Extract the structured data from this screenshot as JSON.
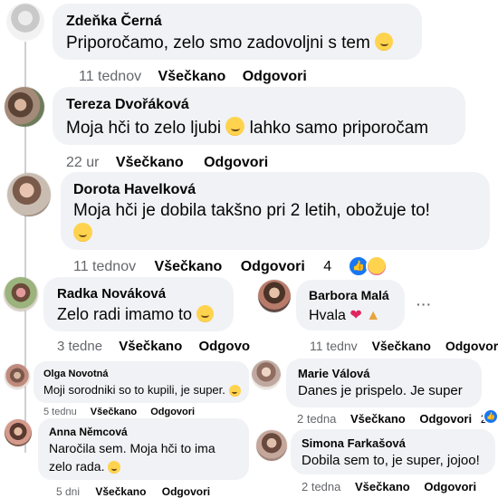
{
  "comments": [
    {
      "name": "Zdeňka Černá",
      "text": "Priporočamo, zelo smo zadovoljni s tem",
      "time": "11 tednov",
      "like": "Všečkano",
      "reply": "Odgovori",
      "emoji": "smiling-face"
    },
    {
      "name": "Tereza Dvořáková",
      "text_before": "Moja hči to zelo ljubi",
      "text_after": "lahko samo priporočam",
      "time": "22 ur",
      "like": "Všečkano",
      "reply": "Odgovori",
      "emoji": "blushing-face"
    },
    {
      "name": "Dorota Havelková",
      "text": "Moja hči je dobila takšno pri 2 letih, obožuje to!",
      "time": "11 tednov",
      "like": "Všečkano",
      "reply": "Odgovori",
      "reaction_count": "4",
      "emoji": "heart-eyes-face"
    },
    {
      "name": "Radka Nováková",
      "text": "Zelo radi imamo to",
      "time": "3 tedne",
      "like": "Všečkano",
      "reply": "Odgovo",
      "emoji": "smiling-face"
    },
    {
      "name": "Barbora Malá",
      "text": "Hvala",
      "time": "11 tednv",
      "like": "Všečkano",
      "reply": "Odgovor",
      "emoji": "heart-and-party-popper"
    },
    {
      "name": "Olga Novotná",
      "text": "Moji sorodniki so to kupili, je super.",
      "time": "5 tednu",
      "like": "Všečkano",
      "reply": "Odgovori",
      "emoji": "smiling-face"
    },
    {
      "name": "Marie Válová",
      "text": "Danes je prispelo. Je super",
      "time": "2 tedna",
      "like": "Všečkano",
      "reply": "Odgovori",
      "reaction_count": "2"
    },
    {
      "name": "Anna Němcová",
      "text_line1": "Naročila sem. Moja hči to ima",
      "text_line2": "zelo rada.",
      "time": "5 dni",
      "like": "Všečkano",
      "reply": "Odgovori",
      "emoji": "smiling-face"
    },
    {
      "name": "Simona Farkašová",
      "text": "Dobila sem to, je super, jojoo!",
      "time": "2 tedna",
      "like": "Všečkano",
      "reply": "Odgovori"
    }
  ],
  "more_options": "···",
  "colors": {
    "bubble": "#f0f2f5",
    "meta_text": "#65676b",
    "like_blue": "#1877f2",
    "heart_red": "#e0245e"
  }
}
